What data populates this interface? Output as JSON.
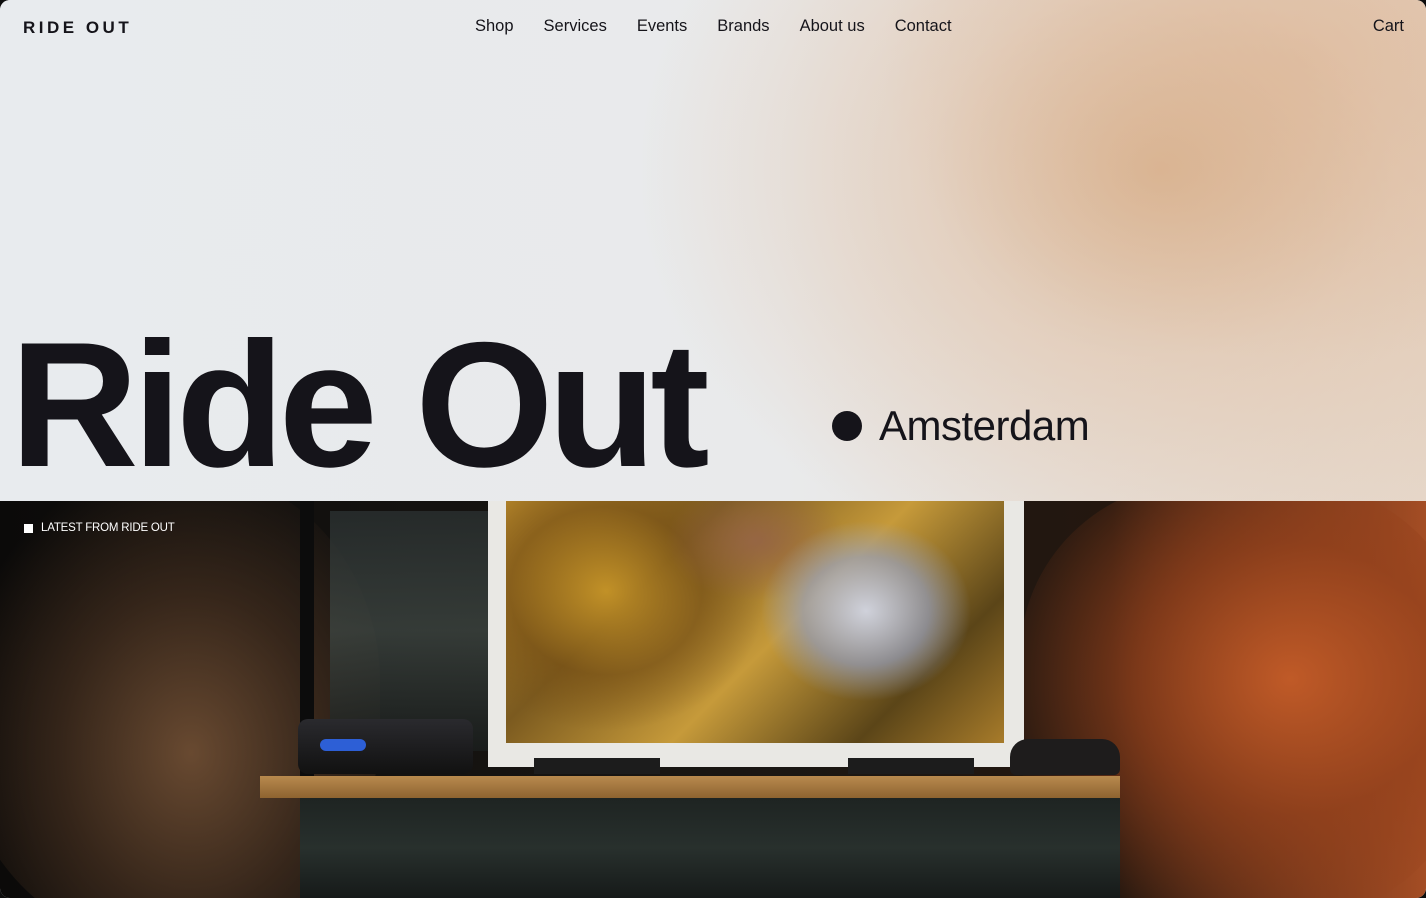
{
  "nav": {
    "logo": "RIDE OUT",
    "items": [
      {
        "label": "Shop"
      },
      {
        "label": "Services"
      },
      {
        "label": "Events"
      },
      {
        "label": "Brands"
      },
      {
        "label": "About us"
      },
      {
        "label": "Contact"
      }
    ],
    "cart": "Cart"
  },
  "hero": {
    "title": "Ride Out",
    "location": "Amsterdam"
  },
  "latest": {
    "label": "LATEST FROM RIDE OUT"
  },
  "colors": {
    "ink": "#15141a",
    "hero_bg": "#e8ebee",
    "accent_warm": "#d9b598"
  }
}
